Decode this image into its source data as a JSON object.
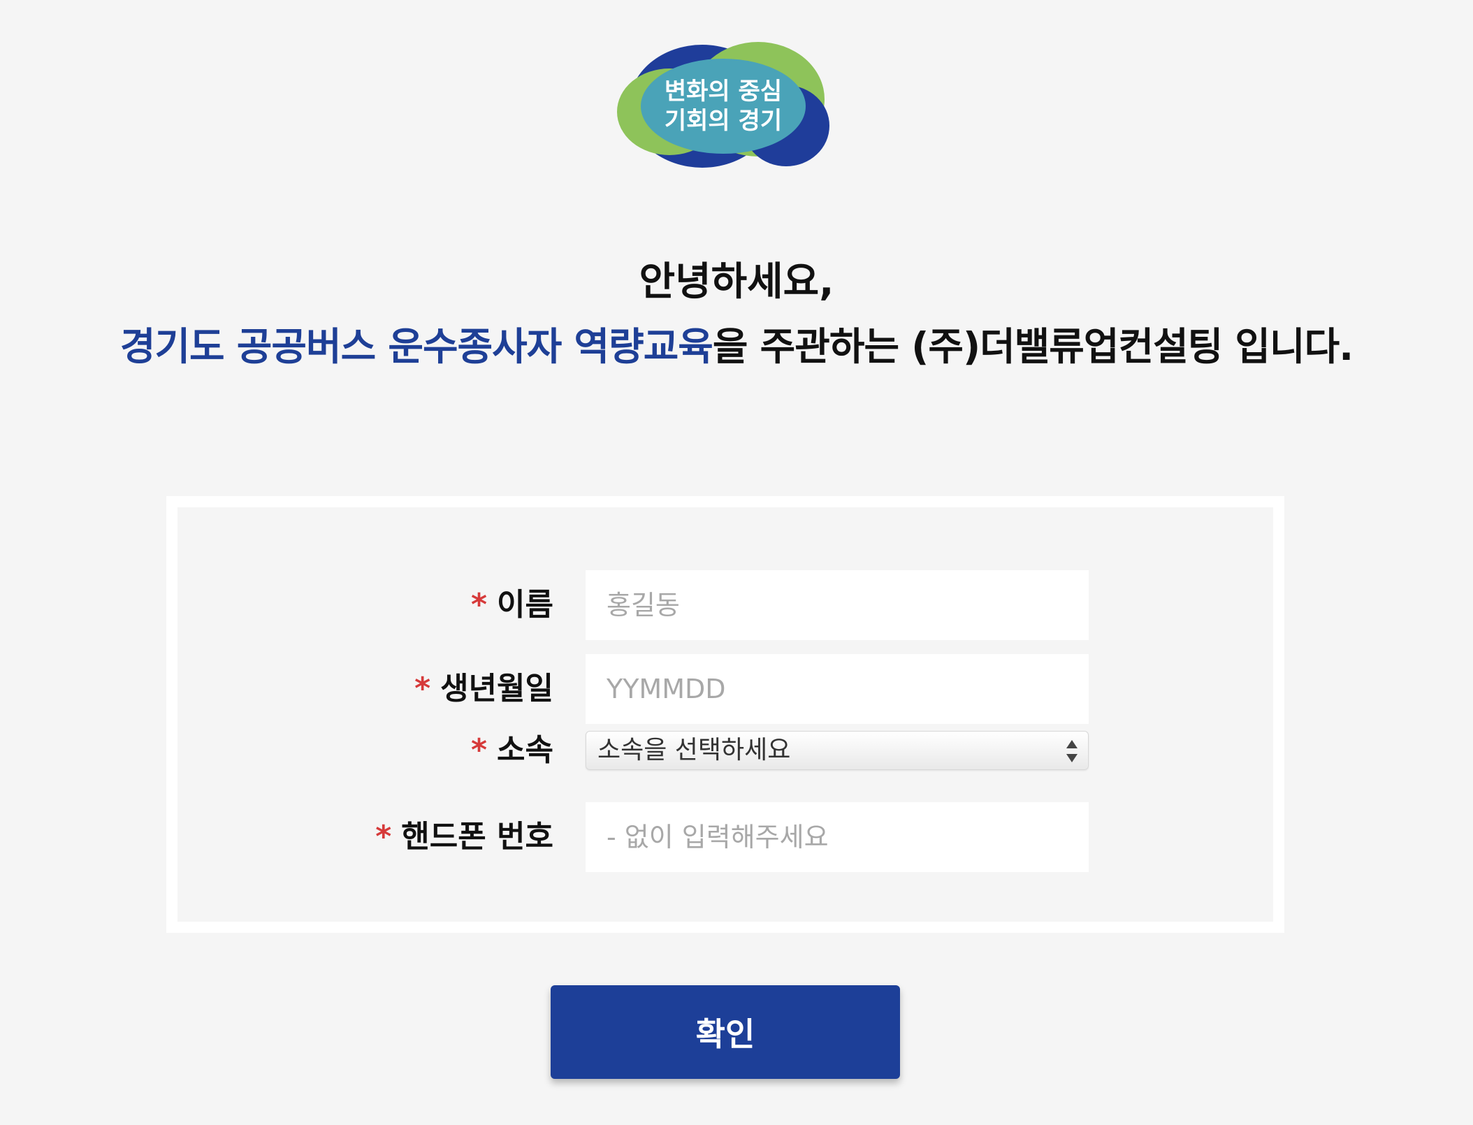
{
  "logo": {
    "line1": "변화의 중심",
    "line2": "기회의 경기",
    "colors": {
      "blue": "#1f3d9a",
      "green": "#8ec35a",
      "teal": "#4aa3b8"
    }
  },
  "header": {
    "greeting": "안녕하세요,",
    "intro_highlight": "경기도 공공버스 운수종사자 역량교육",
    "intro_rest": "을 주관하는 (주)더밸류업컨설팅 입니다."
  },
  "form": {
    "required_mark": "*",
    "fields": {
      "name": {
        "label": "이름",
        "placeholder": "홍길동"
      },
      "birthdate": {
        "label": "생년월일",
        "placeholder": "YYMMDD"
      },
      "affiliation": {
        "label": "소속",
        "selected": "소속을 선택하세요"
      },
      "phone": {
        "label": "핸드폰 번호",
        "placeholder": "- 없이 입력해주세요"
      }
    }
  },
  "actions": {
    "confirm_label": "확인"
  },
  "theme": {
    "accent": "#1d3f98",
    "required": "#d63a3a",
    "background": "#f5f5f5"
  }
}
